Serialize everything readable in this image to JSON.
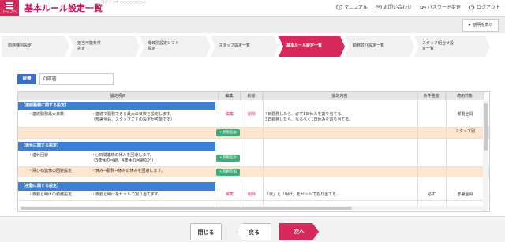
{
  "header": {
    "menu_label": "トップへ",
    "title": "基本ルール設定一覧",
    "breadcrumb": "ログイン中 ○○○○ ○○○○",
    "links": [
      {
        "label": "マニュアル",
        "icon": "book-icon"
      },
      {
        "label": "お問い合わせ",
        "icon": "mail-icon"
      },
      {
        "label": "パスワード変更",
        "icon": "key-icon"
      },
      {
        "label": "ログアウト",
        "icon": "logout-icon"
      }
    ]
  },
  "subbar": {
    "explain_label": "説明を表示"
  },
  "steps": [
    {
      "label": "勤務種別設定"
    },
    {
      "label": "担当可能条件\n設定"
    },
    {
      "label": "曜日別設定シフト\n設定"
    },
    {
      "label": "スタッフ設定一覧"
    },
    {
      "label": "基本ルール設定一覧"
    },
    {
      "label": "勤務並び設定一覧"
    },
    {
      "label": "スタッフ組合せ設\n定一覧"
    }
  ],
  "dept": {
    "label": "部署",
    "value": "D部署"
  },
  "table": {
    "columns": [
      "設定項目",
      "編集",
      "削除",
      "設定内容",
      "条件強度",
      "適用対象"
    ],
    "sections": [
      {
        "title": "【連続勤務に関する設定】"
      },
      {
        "title": "【連休に関する設定】"
      },
      {
        "title": "【夜勤に関する設定】"
      }
    ],
    "rows": [
      {
        "item": "・連続勤務最大日数",
        "desc": "・連続で勤務できる最大の日数を設定します。\n（部署全員、スタッフごとの設定が可能です）",
        "edit": "編集",
        "delete": "削除",
        "content": "4日勤務したら、必ず1日休みを割り当てる。\n3日勤務したら、なるべく1日休みを割り当てる。",
        "strength": "",
        "target": "部署全員"
      },
      {
        "item": "",
        "desc": "",
        "add": "+新規追加",
        "content": "",
        "strength": "",
        "target": "スタッフ別"
      },
      {
        "item": "・連休回避",
        "desc": "・○日間連続の休みを回避します。\n（3連休の回避、4連休の回避など）",
        "add": "+新規追加",
        "content": "",
        "strength": "",
        "target": ""
      },
      {
        "item": "・飛び石連休の回避設定",
        "desc": "・休み→勤務→休みの休みを回避します。",
        "add": "+新規追加",
        "content": "",
        "strength": "",
        "target": ""
      },
      {
        "item": "・夜勤と明けの勤務設定",
        "desc": "・夜勤と明けをセットで割り当てます。",
        "edit": "編集",
        "delete": "削除",
        "content": "「夜」と「明け」をセットで割り当てる。",
        "strength": "必ず",
        "target": "部署全員"
      }
    ]
  },
  "footer": {
    "close": "閉じる",
    "back": "戻る",
    "next": "次へ"
  },
  "colors": {
    "accent": "#d6285a",
    "section_blue": "#3d7fd0",
    "add_green": "#45a87b",
    "peach": "#fde6cf"
  }
}
